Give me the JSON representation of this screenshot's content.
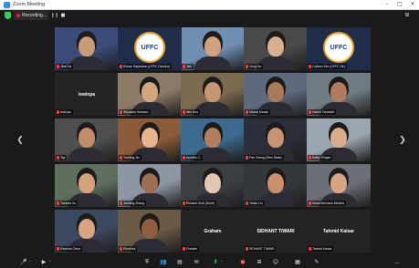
{
  "window": {
    "title": "Zoom Meeting",
    "controls": {
      "minimize": "–",
      "maximize": "□",
      "close": "✕"
    }
  },
  "topbar": {
    "recording_label": "Recording...",
    "pause_icon": "❙❙",
    "stop_icon": "■",
    "view_icon": "⊞"
  },
  "navigation": {
    "prev": "❮",
    "next": "❯"
  },
  "ufc_logo_text": "UFFC",
  "tiles": [
    {
      "kind": "photo",
      "name": "Jihei Ha"
    },
    {
      "kind": "logo",
      "name": "Rohan Rajasekar (UFFC Director)"
    },
    {
      "kind": "photo",
      "name": "Jieli"
    },
    {
      "kind": "photo",
      "name": "Yong Hu"
    },
    {
      "kind": "logo",
      "name": "Colleen Kim (UFFC Dir)"
    },
    {
      "kind": "text",
      "center": "iewinpa",
      "name": "iewinpa"
    },
    {
      "kind": "photo",
      "name": "Wiyuanto Kinahen"
    },
    {
      "kind": "photo",
      "name": "Wei Guo"
    },
    {
      "kind": "photo",
      "name": "Michal Kiczak"
    },
    {
      "kind": "photo",
      "name": "Hamid Farmbeh"
    },
    {
      "kind": "photo",
      "name": "Tay"
    },
    {
      "kind": "photo",
      "name": "Yunbing Jin"
    },
    {
      "kind": "photo",
      "name": "Apratim C."
    },
    {
      "kind": "photo",
      "name": "Pan Zhang (Ohio State)"
    },
    {
      "kind": "photo",
      "name": "Kathy Ringen"
    },
    {
      "kind": "photo",
      "name": "Tianhua Xu"
    },
    {
      "kind": "photo",
      "name": "Jiuxiang Zhang"
    },
    {
      "kind": "photo",
      "name": "Richard Gold (Duke)"
    },
    {
      "kind": "photo",
      "name": "Yixiao Liu"
    },
    {
      "kind": "photo",
      "name": "Maria Mercado-Medina"
    },
    {
      "kind": "photo",
      "name": "Rasmus Olson"
    },
    {
      "kind": "photo",
      "name": "Eboehek"
    },
    {
      "kind": "text",
      "center": "Graham",
      "name": "Graham"
    },
    {
      "kind": "text",
      "center": "SIDHANT TIWARI",
      "name": "SIDHANT TIWARI"
    },
    {
      "kind": "text",
      "center": "Tahmid Kaisar",
      "name": "Tahmid Kaisar"
    }
  ],
  "toolbar": {
    "mute_icon": "🎤",
    "video_icon": "▶",
    "security_icon": "⛨",
    "participants_icon": "👥",
    "polls_icon": "▤",
    "chat_icon": "✉",
    "share_icon": "⬆",
    "record_icon": "●",
    "breakout_icon": "⊞",
    "reactions_icon": "☺",
    "apps_icon": "▦",
    "whiteboard_icon": "✎",
    "more_icon": "…",
    "caret": "⌃",
    "leave_label": "Leave"
  }
}
